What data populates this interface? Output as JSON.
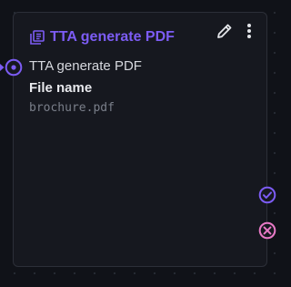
{
  "node": {
    "title": "TTA generate PDF",
    "subtitle": "TTA generate PDF",
    "field_label": "File name",
    "field_value": "brochure.pdf"
  },
  "icons": {
    "header": "library-books-icon",
    "edit": "pencil-icon",
    "menu": "more-vertical-icon",
    "input": "input-handle-icon",
    "success": "check-circle-icon",
    "error": "x-circle-icon"
  },
  "colors": {
    "background": "#101218",
    "card": "#16181f",
    "card_border": "#2c2f38",
    "accent": "#7c5cf4",
    "error": "#e879c6",
    "text": "#d6d8de",
    "muted": "#7a7f8a"
  }
}
